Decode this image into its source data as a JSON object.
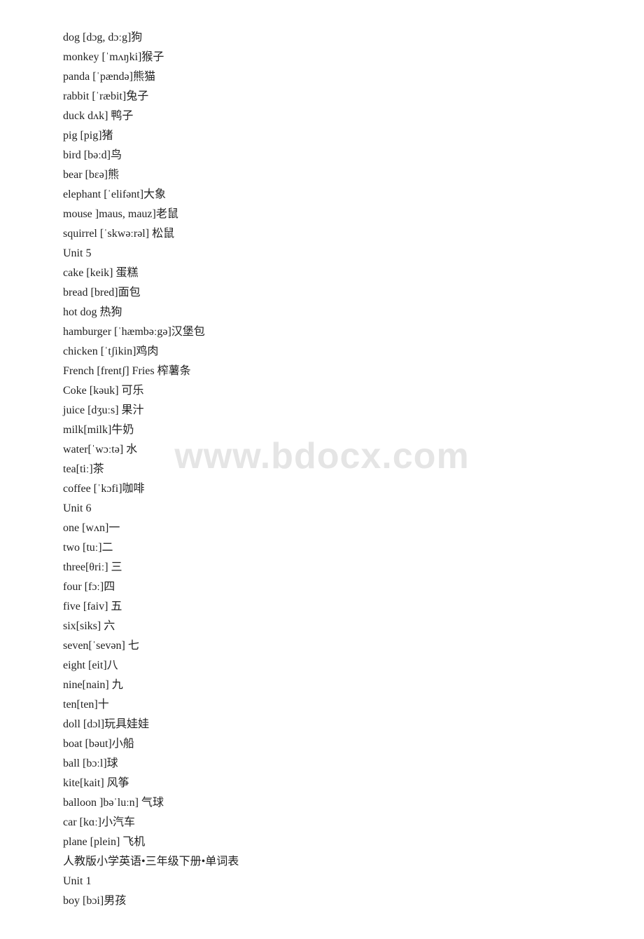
{
  "watermark": "www.bdocx.com",
  "lines": [
    "dog [dɔg, dɔːg]狗",
    "monkey [ˈmʌŋki]猴子",
    "panda [ˈpændə]熊猫",
    "rabbit [ˈræbit]兔子",
    "duck dʌk] 鸭子",
    "pig [pig]猪",
    "bird [bəːd]鸟",
    "bear [bεə]熊",
    "elephant [ˈelifənt]大象",
    "mouse ]maus, mauz]老鼠",
    "squirrel [ˈskwəːrəl] 松鼠",
    " Unit 5",
    "cake [keik] 蛋糕",
    "bread [bred]面包",
    "hot dog 热狗",
    "hamburger [ˈhæmbəːgə]汉堡包",
    "chicken [ˈtʃikin]鸡肉",
    "French [frentʃ]  Fries 榨薯条",
    "Coke [kəuk] 可乐",
    "juice [dʒuːs] 果汁",
    "milk[milk]牛奶",
    "water[ˈwɔːtə] 水",
    "tea[tiː]茶",
    "coffee [ˈkɔfi]咖啡",
    "Unit 6",
    "one [wʌn]一",
    "two [tuː]二",
    "three[θriː] 三",
    "four [fɔː]四",
    "five [faiv]  五",
    "six[siks] 六",
    "seven[ˈsevən] 七",
    "eight [eit]八",
    "nine[nain] 九",
    "ten[ten]十",
    "doll [dɔl]玩具娃娃",
    "boat [bəut]小船",
    "ball [bɔːl]球",
    "kite[kait]  风筝",
    "balloon ]bəˈluːn] 气球",
    "car [kɑː]小汽车",
    "plane [plein] 飞机",
    "人教版小学英语•三年级下册•单词表",
    "Unit 1",
    "boy [bɔi]男孩"
  ]
}
